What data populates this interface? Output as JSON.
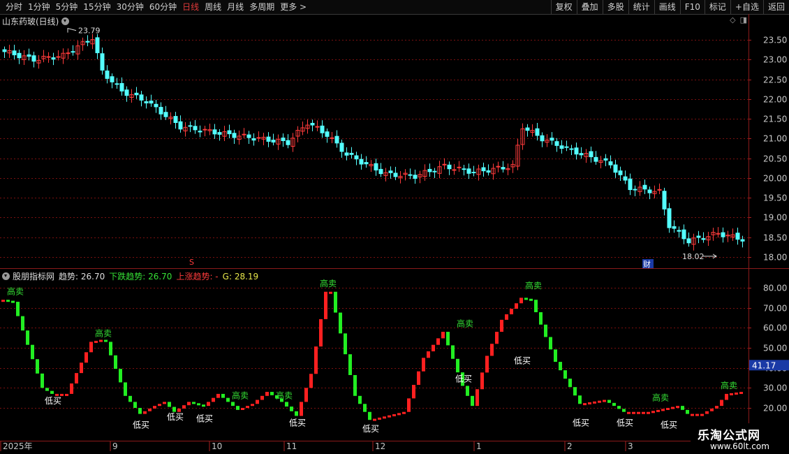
{
  "toolbar": {
    "periods": [
      "分时",
      "1分钟",
      "5分钟",
      "15分钟",
      "30分钟",
      "60分钟",
      "日线",
      "周线",
      "月线",
      "多周期",
      "更多 >"
    ],
    "active_period": "日线",
    "right_buttons": [
      "复权",
      "叠加",
      "多股",
      "统计",
      "画线",
      "F10",
      "标记",
      "+自选",
      "返回"
    ]
  },
  "stock": {
    "title": "山东药玻(日线)",
    "high_label": "23.79",
    "low_label": "18.02",
    "s_marker": "S",
    "cai_marker": "财"
  },
  "price_axis": [
    "23.50",
    "23.00",
    "22.50",
    "22.00",
    "21.50",
    "21.00",
    "20.50",
    "20.00",
    "19.50",
    "19.00",
    "18.50",
    "18.00"
  ],
  "indicator": {
    "name": "股朋指标网",
    "trend_label": "趋势: 26.70",
    "down_label": "下跌趋势: 26.70",
    "up_label": "上涨趋势: -",
    "g_label": "G: 28.19",
    "axis": [
      "80.00",
      "70.00",
      "60.00",
      "50.00",
      "40.00",
      "30.00",
      "20.00"
    ],
    "current_value": "41.17",
    "sell_text": "高卖",
    "buy_text": "低买"
  },
  "date_axis": [
    "2025年",
    "9",
    "10",
    "11",
    "12",
    "1",
    "2",
    "3"
  ],
  "watermark": {
    "main": "乐淘公式网",
    "url": "www.60lt.com"
  },
  "colors": {
    "up": "#ff3b3b",
    "down": "#54ffff",
    "osc_up": "#ff2020",
    "osc_down": "#22ee22",
    "axis_text": "#c8c8c8",
    "grid": "#7a1010"
  }
}
